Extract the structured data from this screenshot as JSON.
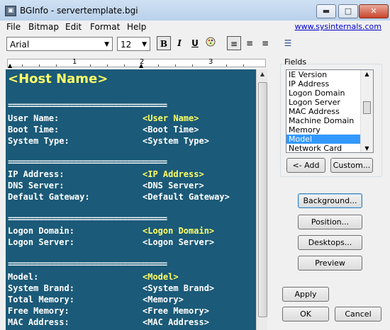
{
  "window": {
    "title": "BGInfo - servertemplate.bgi",
    "min_glyph": "▬",
    "max_glyph": "□",
    "close_glyph": "✕"
  },
  "menu": {
    "items": [
      "File",
      "Bitmap",
      "Edit",
      "Format",
      "Help"
    ],
    "link": "www.sysinternals.com"
  },
  "toolbar": {
    "font": "Arial",
    "size": "12",
    "bold": "B",
    "italic": "I",
    "underline": "U",
    "align_left": "≡",
    "align_center": "≡",
    "align_right": "≡",
    "list": "☰"
  },
  "ruler": {
    "marks": [
      "1",
      "2",
      "3"
    ]
  },
  "editor": {
    "host": "<Host Name>",
    "separator": "====================================",
    "rows": [
      {
        "label": "User Name:",
        "value": "<User Name>"
      },
      {
        "label": "Boot Time:",
        "value": "<Boot Time>"
      },
      {
        "label": "System Type:",
        "value": "<System Type>"
      },
      {
        "label": "IP Address:",
        "value": "<IP Address>"
      },
      {
        "label": "DNS Server:",
        "value": "<DNS Server>"
      },
      {
        "label": "Default Gateway:",
        "value": "<Default Gateway>"
      },
      {
        "label": "Logon Domain:",
        "value": "<Logon Domain>"
      },
      {
        "label": "Logon Server:",
        "value": "<Logon Server>"
      },
      {
        "label": "Model:",
        "value": "<Model>"
      },
      {
        "label": "System Brand:",
        "value": "<System Brand>"
      },
      {
        "label": "Total Memory:",
        "value": "<Memory>"
      },
      {
        "label": "Free Memory:",
        "value": "<Free Memory>"
      },
      {
        "label": "MAC Address:",
        "value": "<MAC Address>"
      }
    ],
    "highlight_color": "#ffff66",
    "background_color": "#1b5a78"
  },
  "fields": {
    "label": "Fields",
    "items": [
      "IE Version",
      "IP Address",
      "Logon Domain",
      "Logon Server",
      "MAC Address",
      "Machine Domain",
      "Memory",
      "Model",
      "Network Card"
    ],
    "selected": "Model"
  },
  "buttons": {
    "add": "<- Add",
    "custom": "Custom...",
    "background": "Background...",
    "position": "Position...",
    "desktops": "Desktops...",
    "preview": "Preview",
    "apply": "Apply",
    "ok": "OK",
    "cancel": "Cancel"
  }
}
